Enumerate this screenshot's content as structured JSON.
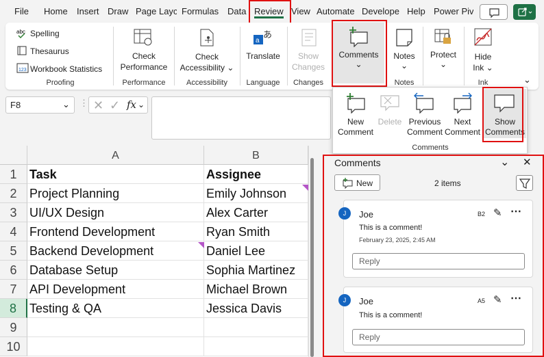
{
  "tabs": [
    "File",
    "Home",
    "Insert",
    "Draw",
    "Page Layc",
    "Formulas",
    "Data",
    "Review",
    "View",
    "Automate",
    "Develope",
    "Help",
    "Power Piv"
  ],
  "ribbon": {
    "proofing": {
      "spelling": "Spelling",
      "thesaurus": "Thesaurus",
      "workbook_statistics": "Workbook Statistics",
      "label": "Proofing",
      "abc": "abc",
      "num": "123"
    },
    "performance": {
      "line1": "Check",
      "line2": "Performance",
      "label": "Performance"
    },
    "accessibility": {
      "line1": "Check",
      "line2": "Accessibility",
      "label": "Accessibility"
    },
    "language": {
      "translate": "Translate",
      "label": "Language"
    },
    "changes": {
      "line1": "Show",
      "line2": "Changes",
      "label": "Changes"
    },
    "comments": {
      "label": "Comments"
    },
    "notes": {
      "label": "Notes",
      "group_label": "Notes"
    },
    "protect": {
      "label": "Protect"
    },
    "ink": {
      "line1": "Hide",
      "line2": "Ink",
      "label": "Ink"
    }
  },
  "popup": {
    "new_line1": "New",
    "new_line2": "Comment",
    "delete": "Delete",
    "prev_line1": "Previous",
    "prev_line2": "Comment",
    "next_line1": "Next",
    "next_line2": "Comment",
    "show_line1": "Show",
    "show_line2": "Comments",
    "label": "Comments"
  },
  "formula": {
    "cell_ref": "F8",
    "fx": "fx",
    "value": ""
  },
  "sheet": {
    "columns": [
      "A",
      "B"
    ],
    "rows": [
      {
        "num": "1",
        "a": "Task",
        "b": "Assignee"
      },
      {
        "num": "2",
        "a": "Project Planning",
        "b": "Emily Johnson"
      },
      {
        "num": "3",
        "a": "UI/UX Design",
        "b": "Alex Carter"
      },
      {
        "num": "4",
        "a": "Frontend Development",
        "b": "Ryan Smith"
      },
      {
        "num": "5",
        "a": "Backend Development",
        "b": "Daniel Lee"
      },
      {
        "num": "6",
        "a": "Database Setup",
        "b": "Sophia Martinez"
      },
      {
        "num": "7",
        "a": "API Development",
        "b": "Michael Brown"
      },
      {
        "num": "8",
        "a": "Testing & QA",
        "b": "Jessica Davis"
      },
      {
        "num": "9",
        "a": "",
        "b": ""
      },
      {
        "num": "10",
        "a": "",
        "b": ""
      }
    ]
  },
  "comments_pane": {
    "title": "Comments",
    "new_label": "New",
    "count": "2 items",
    "threads": [
      {
        "initial": "J",
        "author": "Joe",
        "cell": "B2",
        "text": "This is a comment!",
        "timestamp": "February 23, 2025, 2:45 AM",
        "reply_placeholder": "Reply"
      },
      {
        "initial": "J",
        "author": "Joe",
        "cell": "A5",
        "text": "This is a comment!",
        "reply_placeholder": "Reply"
      }
    ]
  },
  "colors": {
    "accent": "#1e7145",
    "highlight": "#e01010",
    "avatar": "#1565c0",
    "comment_marker": "#b455c7"
  }
}
